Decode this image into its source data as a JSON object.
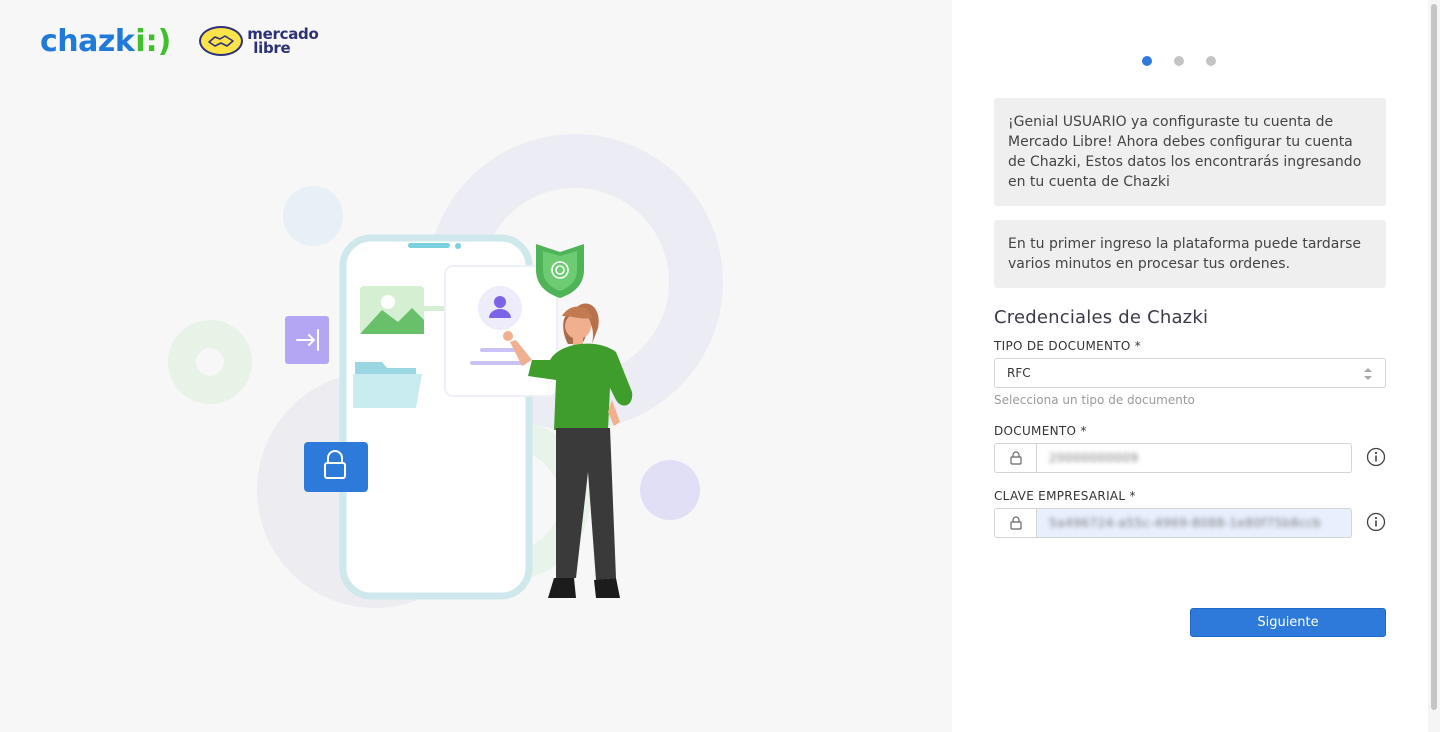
{
  "brand": {
    "chazki_word": "chazk",
    "chazki_mark": "i:)",
    "ml_line1": "mercado",
    "ml_line2": "libre"
  },
  "stepper": {
    "total": 3,
    "active": 1
  },
  "messages": {
    "config_text": "¡Genial USUARIO ya configuraste tu cuenta de Mercado Libre! Ahora debes configurar tu cuenta de Chazki, Estos datos los encontrarás ingresando en tu cuenta de Chazki",
    "delay_text": "En tu primer ingreso la plataforma puede tardarse varios minutos en procesar tus ordenes."
  },
  "form": {
    "section_title": "Credenciales de Chazki",
    "tipo_label": "TIPO DE DOCUMENTO *",
    "tipo_value": "RFC",
    "tipo_helper": "Selecciona un tipo de documento",
    "documento_label": "DOCUMENTO *",
    "documento_value": "20000000009",
    "clave_label": "CLAVE EMPRESARIAL *",
    "clave_value": "5a496724-a55c-4969-8088-1e80f75b8ccb",
    "submit_label": "Siguiente"
  },
  "colors": {
    "primary": "#2d7adb",
    "chazki_blue": "#1f7ad9",
    "chazki_green": "#3fc12c",
    "ml_yellow": "#fde34a",
    "ml_navy": "#2d3277"
  }
}
